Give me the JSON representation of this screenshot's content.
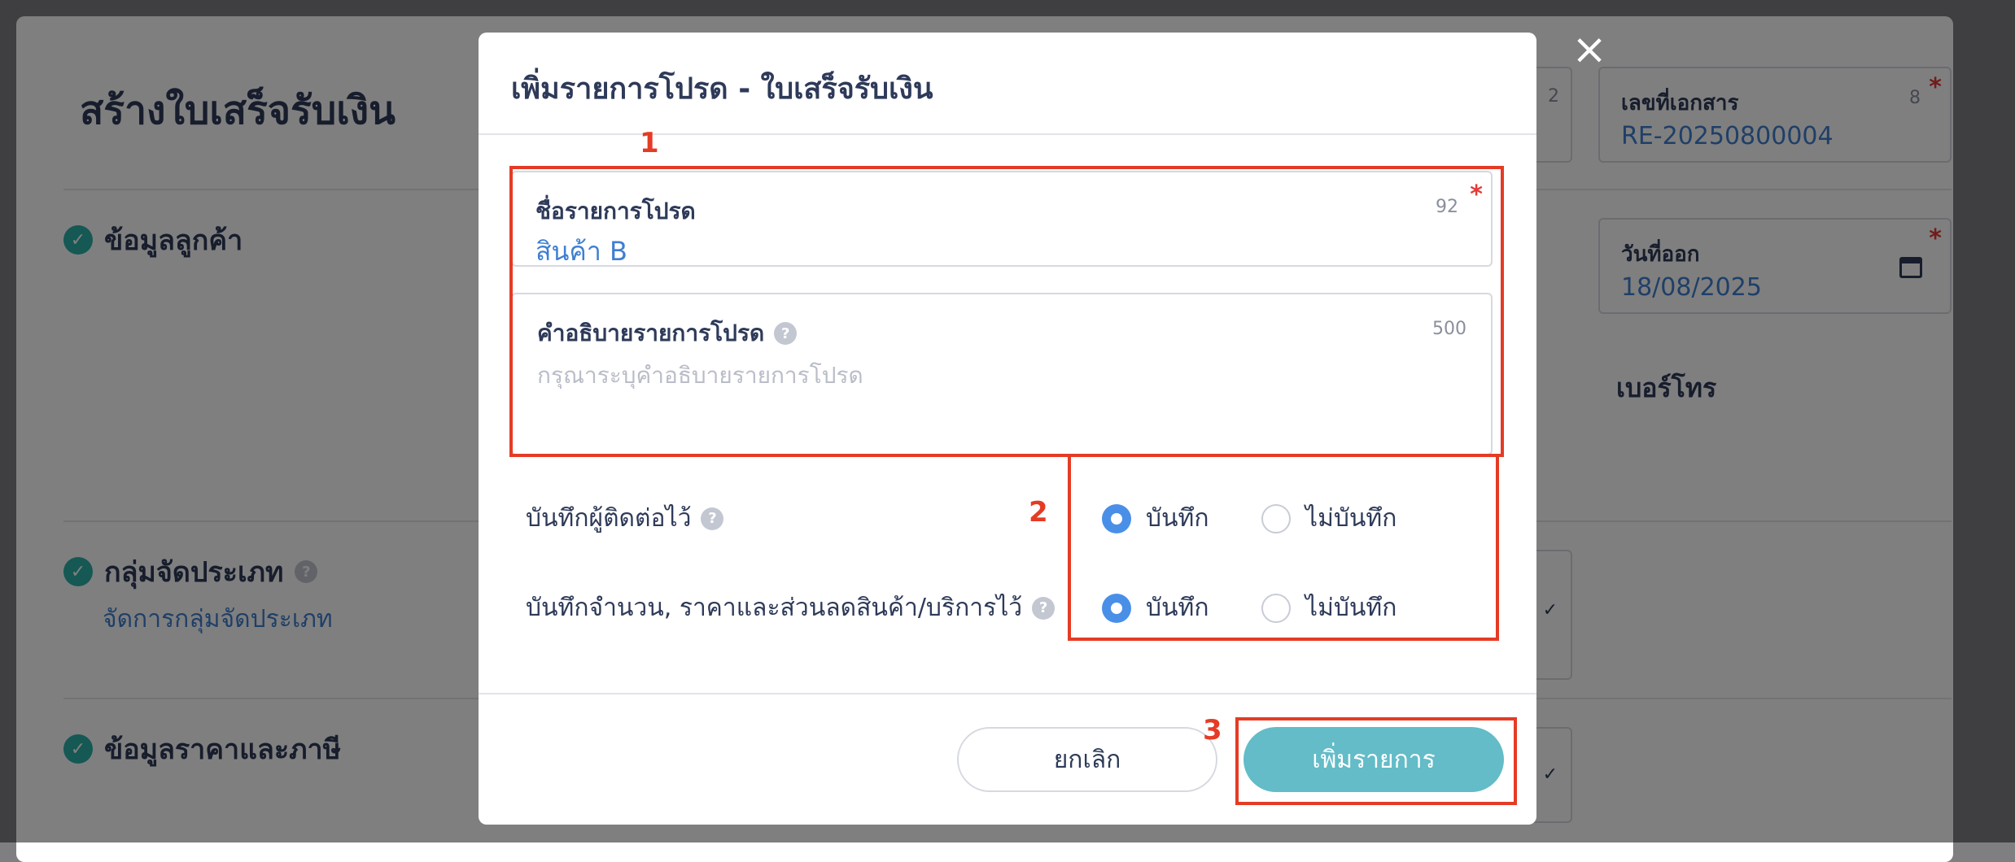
{
  "background": {
    "page_title": "สร้างใบเสร็จรับเงิน",
    "sections": {
      "customer": "ข้อมูลลูกค้า",
      "category": "กลุ่มจัดประเภท",
      "category_link": "จัดการกลุ่มจัดประเภท",
      "pricing": "ข้อมูลราคาและภาษี"
    },
    "doc_number": {
      "label": "เลขที่เอกสาร",
      "value": "RE-20250800004",
      "count": "8"
    },
    "issue_date": {
      "label": "วันที่ออก",
      "value": "18/08/2025"
    },
    "phone_label": "เบอร์โทร",
    "partial_count": "2"
  },
  "modal": {
    "title": "เพิ่มรายการโปรด - ใบเสร็จรับเงิน",
    "close_icon": "×",
    "name_field": {
      "label": "ชื่อรายการโปรด",
      "value": "สินค้า B",
      "count": "92"
    },
    "desc_field": {
      "label": "คำอธิบายรายการโปรด",
      "placeholder": "กรุณาระบุคำอธิบายรายการโปรด",
      "count": "500"
    },
    "options": [
      {
        "label": "บันทึกผู้ติดต่อไว้",
        "opt_yes": "บันทึก",
        "opt_no": "ไม่บันทึก",
        "selected": "yes"
      },
      {
        "label": "บันทึกจำนวน, ราคาและส่วนลดสินค้า/บริการไว้",
        "opt_yes": "บันทึก",
        "opt_no": "ไม่บันทึก",
        "selected": "yes"
      }
    ],
    "cancel_label": "ยกเลิก",
    "add_label": "เพิ่มรายการ"
  },
  "annotations": [
    "1",
    "2",
    "3"
  ],
  "colors": {
    "accent": "#63bcc8",
    "link": "#3f7fd1",
    "annotation": "#e53b25",
    "check": "#2bb0a8"
  }
}
